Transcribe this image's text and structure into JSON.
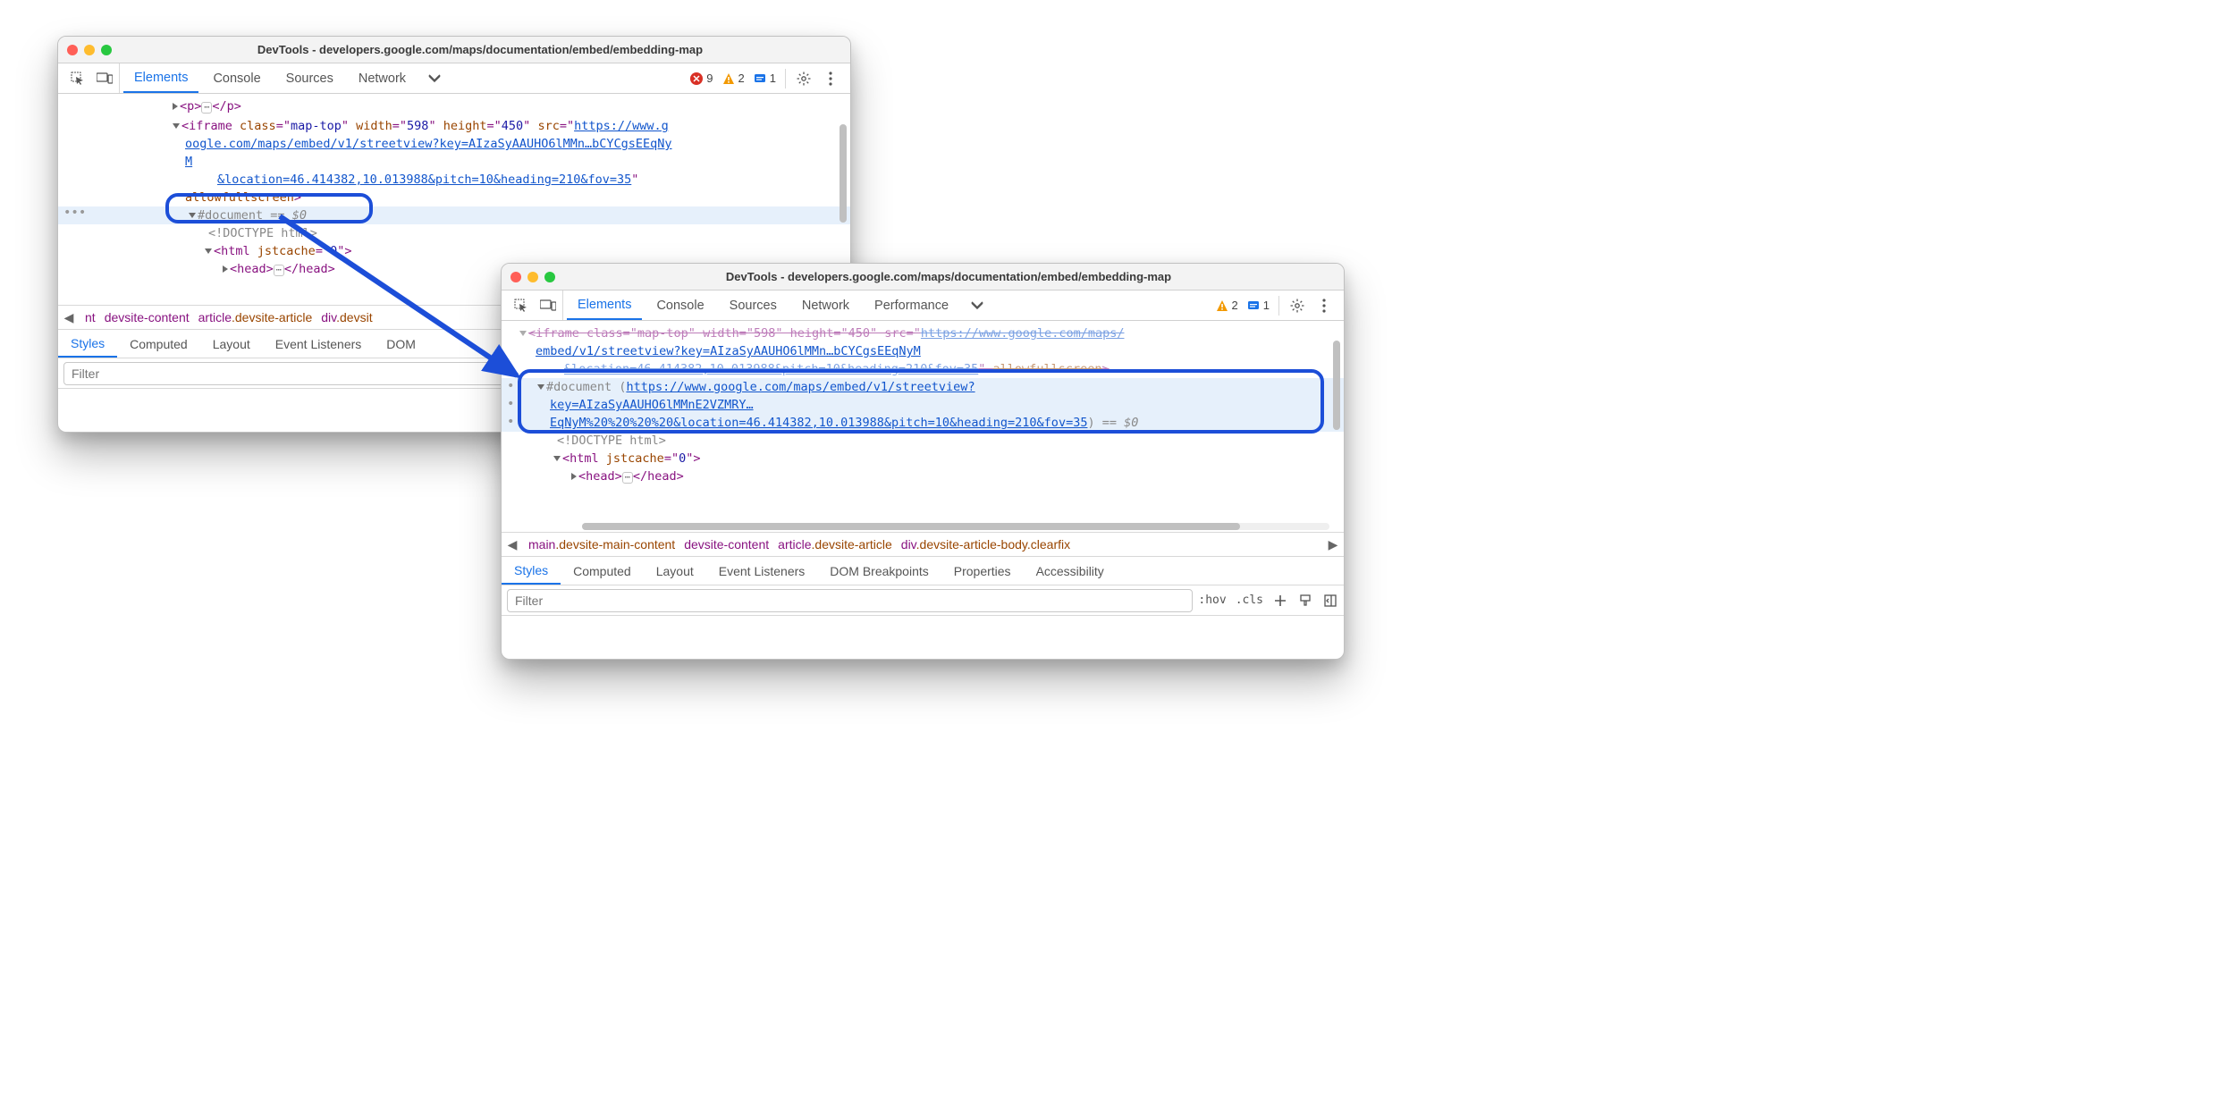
{
  "window1": {
    "title": "DevTools - developers.google.com/maps/documentation/embed/embedding-map",
    "tabs": {
      "elements": "Elements",
      "console": "Console",
      "sources": "Sources",
      "network": "Network"
    },
    "badges": {
      "errors": "9",
      "warnings": "2",
      "info": "1"
    },
    "dom": {
      "p_open": "<p>",
      "p_close": "</p>",
      "iframe_open": "<iframe",
      "attr_class": "class",
      "val_class": "map-top",
      "attr_width": "width",
      "val_width": "598",
      "attr_height": "height",
      "val_height": "450",
      "attr_src": "src",
      "link_l1": "https://www.g",
      "link_l2": "oogle.com/maps/embed/v1/streetview?key=AIzaSyAAUHO6lMMn…bCYCgsEEqNy",
      "link_l3": "M",
      "link_l4": "&location=46.414382,10.013988&pitch=10&heading=210&fov=35",
      "allowfs": "allowfullscreen",
      "document": "#document",
      "eqeq": "==",
      "dollar0": "$0",
      "doctype": "<!DOCTYPE html>",
      "html_open": "<html",
      "jstcache": "jstcache",
      "jst_val": "0",
      "head_open": "<head>",
      "head_close": "</head>"
    },
    "breadcrumb": {
      "c1": "nt",
      "c2": "devsite-content",
      "c3_el": "article",
      "c3_cls": ".devsite-article",
      "c4_el": "div",
      "c4_cls": ".devsit"
    },
    "subtabs": {
      "styles": "Styles",
      "computed": "Computed",
      "layout": "Layout",
      "event": "Event Listeners",
      "dom": "DOM"
    },
    "filter_placeholder": "Filter"
  },
  "window2": {
    "title": "DevTools - developers.google.com/maps/documentation/embed/embedding-map",
    "tabs": {
      "elements": "Elements",
      "console": "Console",
      "sources": "Sources",
      "network": "Network",
      "performance": "Performance"
    },
    "badges": {
      "warnings": "2",
      "info": "1"
    },
    "dom": {
      "iframe_strike": "<iframe class=\"map-top\" width=\"598\" height=\"450\" src=\"",
      "iframe_link_top": "https://www.google.com/maps/",
      "line2_link": "embed/v1/streetview?key=AIzaSyAAUHO6lMMn…bCYCgsEEqNyM",
      "line3_strike_a": "&location=46.414382,10.013988&pitch=10&heading=210&fov=35",
      "line3_strike_b": "allowfullscreen",
      "document": "#document",
      "doc_link_l1": "https://www.google.com/maps/embed/v1/streetview?",
      "doc_link_l2": "key=AIzaSyAAUHO6lMMnE2VZMRY…",
      "doc_link_l3": "EqNyM%20%20%20%20&location=46.414382,10.013988&pitch=10&heading=210&fov=35",
      "eqeq": "==",
      "dollar0": "$0",
      "doctype": "<!DOCTYPE html>",
      "html_open": "<html",
      "jstcache": "jstcache",
      "jst_val": "0",
      "head_open": "<head>",
      "head_close": "</head>"
    },
    "breadcrumb": {
      "c1_el": "main",
      "c1_cls": ".devsite-main-content",
      "c2": "devsite-content",
      "c3_el": "article",
      "c3_cls": ".devsite-article",
      "c4_el": "div",
      "c4_cls": ".devsite-article-body.clearfix"
    },
    "subtabs": {
      "styles": "Styles",
      "computed": "Computed",
      "layout": "Layout",
      "event": "Event Listeners",
      "dom": "DOM Breakpoints",
      "properties": "Properties",
      "accessibility": "Accessibility"
    },
    "filter_placeholder": "Filter",
    "filter_tools": {
      "hov": ":hov",
      "cls": ".cls"
    }
  }
}
